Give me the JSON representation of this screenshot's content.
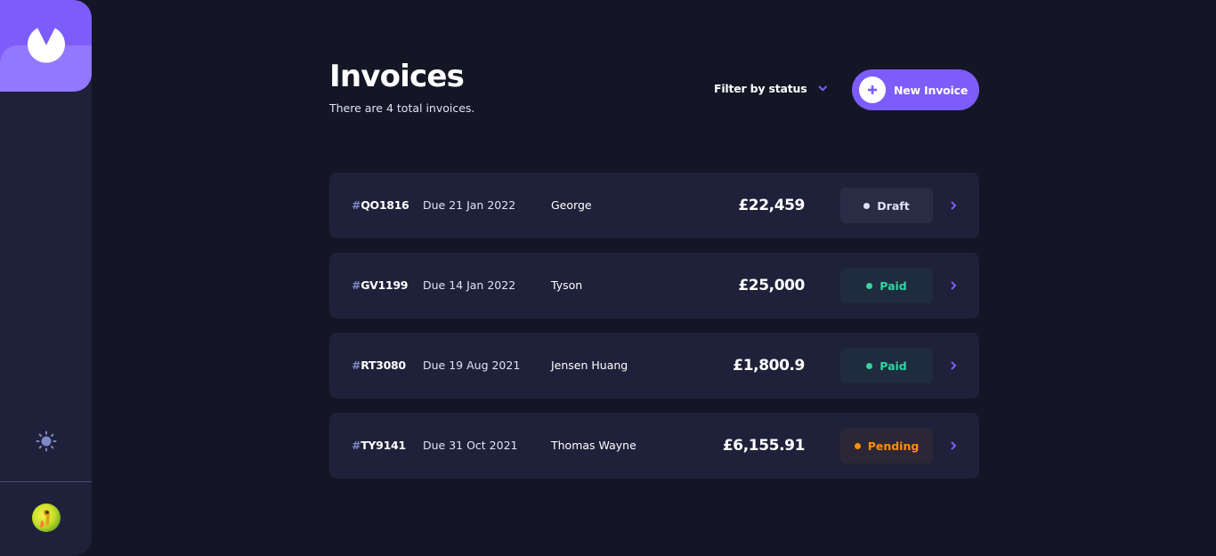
{
  "page": {
    "title": "Invoices",
    "subtitle": "There are 4 total invoices."
  },
  "filter": {
    "label": "Filter by status",
    "icon": "chevron-down-icon"
  },
  "new_invoice": {
    "label": "New Invoice",
    "icon": "plus-icon"
  },
  "sidebar": {
    "logo_icon": "app-logo-icon",
    "theme_icon": "sun-icon",
    "avatar": "user-avatar"
  },
  "colors": {
    "accent": "#7c5dfa",
    "accent_light": "#9277ff",
    "background": "#141625",
    "card": "#1e2139",
    "paid": "#33d69f",
    "pending": "#ff8f00",
    "draft": "#dfe3fa"
  },
  "invoices": [
    {
      "hash": "#",
      "id": "QO1816",
      "due": "Due 21 Jan 2022",
      "client": "George",
      "amount": "£22,459",
      "status": "Draft",
      "status_key": "draft"
    },
    {
      "hash": "#",
      "id": "GV1199",
      "due": "Due 14 Jan 2022",
      "client": "Tyson",
      "amount": "£25,000",
      "status": "Paid",
      "status_key": "paid"
    },
    {
      "hash": "#",
      "id": "RT3080",
      "due": "Due 19 Aug 2021",
      "client": "Jensen Huang",
      "amount": "£1,800.9",
      "status": "Paid",
      "status_key": "paid"
    },
    {
      "hash": "#",
      "id": "TY9141",
      "due": "Due 31 Oct 2021",
      "client": "Thomas Wayne",
      "amount": "£6,155.91",
      "status": "Pending",
      "status_key": "pending"
    }
  ]
}
